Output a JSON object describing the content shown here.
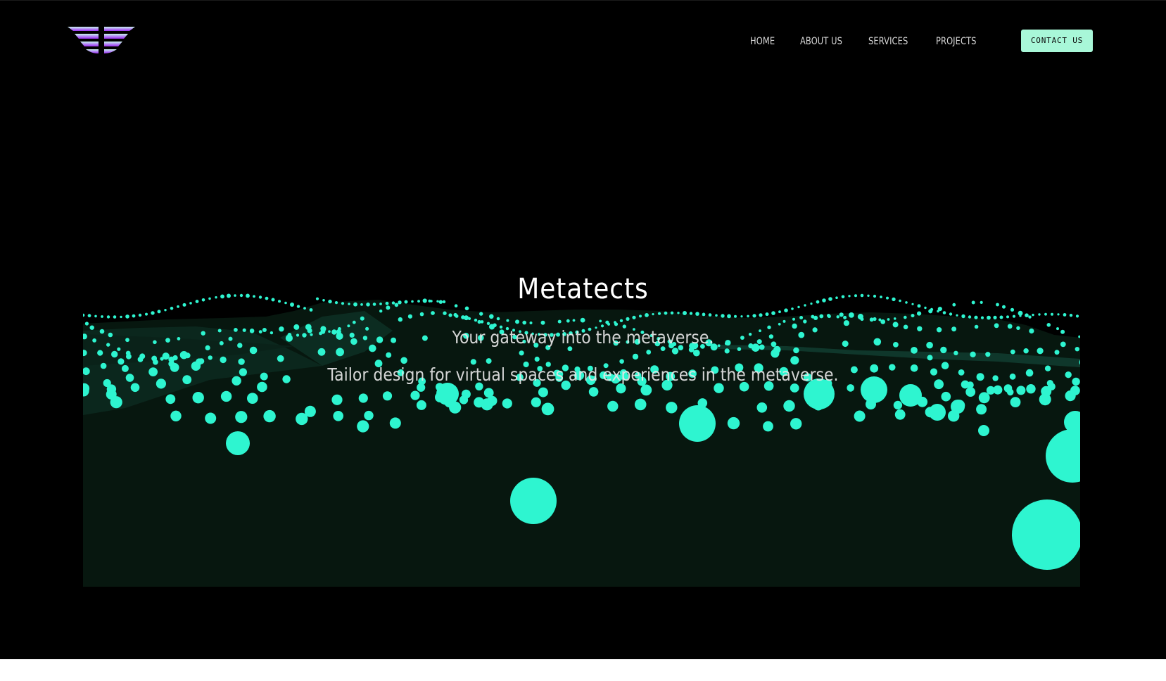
{
  "brand": {
    "logo_icon": "wings-logo-icon",
    "gradient_top": "#bff3e6",
    "gradient_bottom": "#a03cf0"
  },
  "nav": {
    "items": [
      {
        "label": "HOME"
      },
      {
        "label": "ABOUT US"
      },
      {
        "label": "SERVICES"
      },
      {
        "label": "PROJECTS"
      }
    ],
    "cta_label": "CONTACT US"
  },
  "hero": {
    "title": "Metatects",
    "tagline": "Your gateway into the metaverse.",
    "subtitle": "Tailor design for virtual spaces and experiences in the metaverse.",
    "visual": "particle-wave-landscape",
    "accent_color": "#2ef5d0",
    "panel_color": "#07170f"
  }
}
